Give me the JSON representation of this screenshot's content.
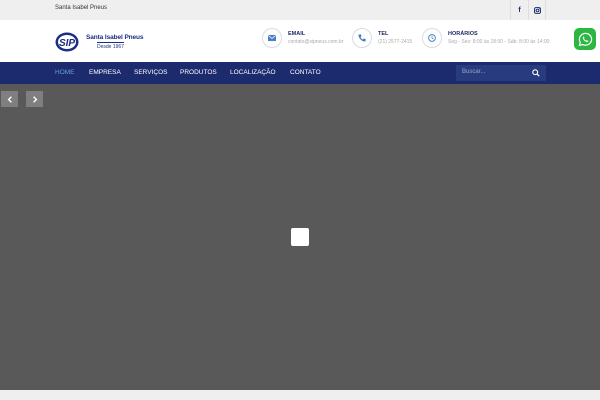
{
  "topbar": {
    "site_name": "Santa Isabel Pneus",
    "social": [
      {
        "icon": "facebook-icon",
        "glyph": "f"
      },
      {
        "icon": "instagram-icon",
        "glyph": "◘"
      }
    ]
  },
  "logo": {
    "name": "Santa Isabel Pneus",
    "since": "Desde 1967",
    "brand_color": "#1b2d84"
  },
  "contact": [
    {
      "icon": "envelope-icon",
      "title": "EMAIL",
      "value": "contato@sipneus.com.br"
    },
    {
      "icon": "phone-icon",
      "title": "TEL",
      "value": "(21) 2577-2415"
    },
    {
      "icon": "clock-icon",
      "title": "HORÁRIOS",
      "value": "Seg - Sex: 8:00 às 18:00 - Sáb: 8:00 às 14:00"
    }
  ],
  "nav": {
    "items": [
      {
        "label": "HOME",
        "active": true
      },
      {
        "label": "EMPRESA"
      },
      {
        "label": "SERVIÇOS"
      },
      {
        "label": "PRODUTOS"
      },
      {
        "label": "LOCALIZAÇÃO"
      },
      {
        "label": "CONTATO"
      }
    ]
  },
  "search": {
    "placeholder": "Buscar..."
  },
  "slider": {
    "prev_icon": "chevron-left-icon",
    "next_icon": "chevron-right-icon",
    "prev_glyph": "‹",
    "next_glyph": "›"
  },
  "colors": {
    "nav_bg": "#1c2b6e",
    "accent": "#6a9ed8",
    "whatsapp": "#2cb742",
    "slider_bg": "#595959"
  }
}
